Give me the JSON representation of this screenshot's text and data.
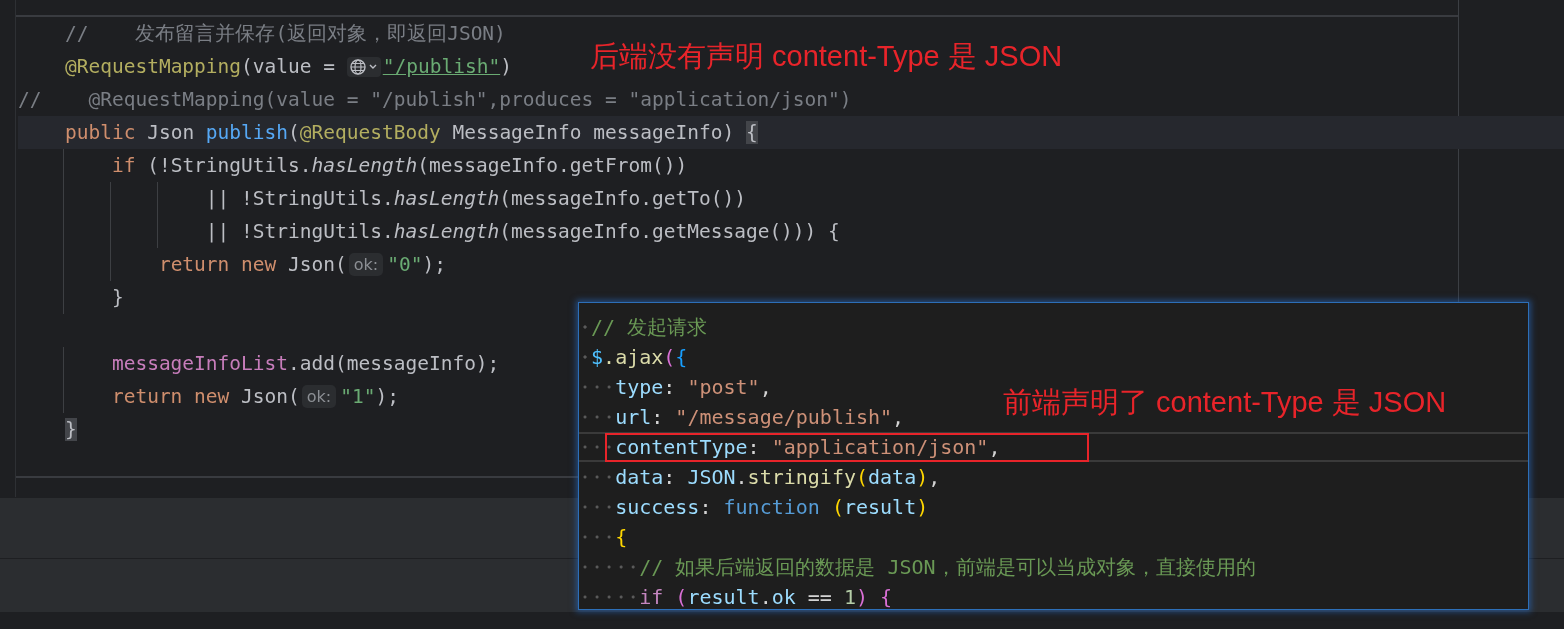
{
  "editor": {
    "lines": [
      {
        "current": false,
        "tokens": [
          {
            "kind": "cmt",
            "text": "    //    发布留言并保存(返回对象，即返回JSON)"
          }
        ]
      },
      {
        "current": false,
        "tokens": [
          {
            "kind": "ann",
            "text": "    @RequestMapping"
          },
          {
            "kind": "plain",
            "text": "(value = "
          },
          {
            "kind": "url-icon"
          },
          {
            "kind": "link",
            "text": "\"/publish\""
          },
          {
            "kind": "plain",
            "text": ")"
          }
        ]
      },
      {
        "current": false,
        "tokens": [
          {
            "kind": "cmt",
            "text": "//    @RequestMapping(value = \"/publish\",produces = \"application/json\")"
          }
        ]
      },
      {
        "current": true,
        "tokens": [
          {
            "kind": "kw",
            "text": "    public "
          },
          {
            "kind": "plain",
            "text": "Json "
          },
          {
            "kind": "fn",
            "text": "publish"
          },
          {
            "kind": "plain",
            "text": "("
          },
          {
            "kind": "ann",
            "text": "@RequestBody "
          },
          {
            "kind": "plain",
            "text": "MessageInfo messageInfo) "
          },
          {
            "kind": "brace-match",
            "text": "{"
          }
        ]
      },
      {
        "current": false,
        "tokens": [
          {
            "kind": "kw",
            "text": "        if "
          },
          {
            "kind": "plain",
            "text": "(!StringUtils."
          },
          {
            "kind": "static",
            "text": "hasLength"
          },
          {
            "kind": "plain",
            "text": "(messageInfo.getFrom())"
          }
        ]
      },
      {
        "current": false,
        "tokens": [
          {
            "kind": "plain",
            "text": "                || !StringUtils."
          },
          {
            "kind": "static",
            "text": "hasLength"
          },
          {
            "kind": "plain",
            "text": "(messageInfo.getTo())"
          }
        ]
      },
      {
        "current": false,
        "tokens": [
          {
            "kind": "plain",
            "text": "                || !StringUtils."
          },
          {
            "kind": "static",
            "text": "hasLength"
          },
          {
            "kind": "plain",
            "text": "(messageInfo.getMessage())) {"
          }
        ]
      },
      {
        "current": false,
        "tokens": [
          {
            "kind": "kw",
            "text": "            return new "
          },
          {
            "kind": "plain",
            "text": "Json("
          },
          {
            "kind": "hint",
            "text": "ok:"
          },
          {
            "kind": "str",
            "text": "\"0\""
          },
          {
            "kind": "plain",
            "text": ");"
          }
        ]
      },
      {
        "current": false,
        "tokens": [
          {
            "kind": "plain",
            "text": "        }"
          }
        ]
      },
      {
        "current": false
      },
      {
        "current": false,
        "tokens": [
          {
            "kind": "field",
            "text": "        messageInfoList"
          },
          {
            "kind": "plain",
            "text": ".add(messageInfo);"
          }
        ]
      },
      {
        "current": false,
        "tokens": [
          {
            "kind": "kw",
            "text": "        return new "
          },
          {
            "kind": "plain",
            "text": "Json("
          },
          {
            "kind": "hint",
            "text": "ok:"
          },
          {
            "kind": "str",
            "text": "\"1\""
          },
          {
            "kind": "plain",
            "text": ");"
          }
        ]
      },
      {
        "current": false,
        "tokens": [
          {
            "kind": "brace-match",
            "text": "    }"
          }
        ]
      }
    ]
  },
  "annotations": [
    {
      "text": "后端没有声明 content-Type 是 JSON"
    },
    {
      "text": "前端声明了 content-Type 是 JSON"
    }
  ],
  "popup": {
    "lines": [
      {
        "current": false,
        "boxed": false,
        "tokens": [
          {
            "kind": "cmt",
            "text": " // 发起请求"
          }
        ]
      },
      {
        "current": false,
        "boxed": false,
        "tokens": [
          {
            "kind": "var2",
            "text": " $"
          },
          {
            "kind": "fn",
            "text": ".ajax"
          },
          {
            "kind": "b2",
            "text": "("
          },
          {
            "kind": "b3",
            "text": "{"
          }
        ]
      },
      {
        "current": false,
        "boxed": false,
        "tokens": [
          {
            "kind": "var",
            "text": "   type"
          },
          {
            "kind": "plain",
            "text": ": "
          },
          {
            "kind": "str",
            "text": "\"post\""
          },
          {
            "kind": "plain",
            "text": ","
          }
        ]
      },
      {
        "current": false,
        "boxed": false,
        "tokens": [
          {
            "kind": "var",
            "text": "   url"
          },
          {
            "kind": "plain",
            "text": ": "
          },
          {
            "kind": "str",
            "text": "\"/message/publish\""
          },
          {
            "kind": "plain",
            "text": ","
          }
        ]
      },
      {
        "current": true,
        "boxed": true,
        "tokens": [
          {
            "kind": "var",
            "text": "   contentType"
          },
          {
            "kind": "plain",
            "text": ": "
          },
          {
            "kind": "str",
            "text": "\"application/json\""
          },
          {
            "kind": "plain",
            "text": ","
          }
        ]
      },
      {
        "current": false,
        "boxed": false,
        "tokens": [
          {
            "kind": "var",
            "text": "   data"
          },
          {
            "kind": "plain",
            "text": ": "
          },
          {
            "kind": "var",
            "text": "JSON"
          },
          {
            "kind": "plain",
            "text": "."
          },
          {
            "kind": "fn",
            "text": "stringify"
          },
          {
            "kind": "b1",
            "text": "("
          },
          {
            "kind": "var",
            "text": "data"
          },
          {
            "kind": "b1",
            "text": ")"
          },
          {
            "kind": "plain",
            "text": ","
          }
        ]
      },
      {
        "current": false,
        "boxed": false,
        "tokens": [
          {
            "kind": "var",
            "text": "   success"
          },
          {
            "kind": "plain",
            "text": ": "
          },
          {
            "kind": "kw",
            "text": "function "
          },
          {
            "kind": "b1",
            "text": "("
          },
          {
            "kind": "var",
            "text": "result"
          },
          {
            "kind": "b1",
            "text": ")"
          }
        ]
      },
      {
        "current": false,
        "boxed": false,
        "tokens": [
          {
            "kind": "b1",
            "text": "   {"
          }
        ]
      },
      {
        "current": false,
        "boxed": false,
        "tokens": [
          {
            "kind": "cmt",
            "text": "     // 如果后端返回的数据是 JSON，前端是可以当成对象，直接使用的"
          }
        ]
      },
      {
        "current": false,
        "boxed": false,
        "tokens": [
          {
            "kind": "ctrl",
            "text": "     if "
          },
          {
            "kind": "b2",
            "text": "("
          },
          {
            "kind": "var",
            "text": "result"
          },
          {
            "kind": "plain",
            "text": "."
          },
          {
            "kind": "var",
            "text": "ok"
          },
          {
            "kind": "plain",
            "text": " == "
          },
          {
            "kind": "num",
            "text": "1"
          },
          {
            "kind": "b2",
            "text": ")"
          },
          {
            "kind": "b2",
            "text": " {"
          }
        ]
      }
    ]
  }
}
